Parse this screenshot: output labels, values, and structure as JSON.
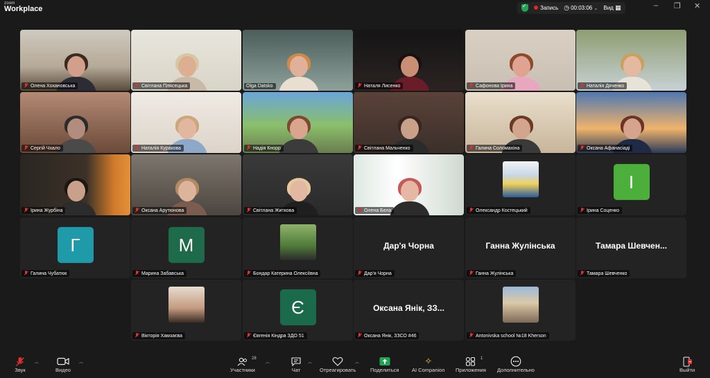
{
  "app": {
    "logo_small": "zoom",
    "logo_big": "Workplace"
  },
  "status": {
    "recording_label": "Запись",
    "timer": "00:03:06",
    "view_label": "Вид"
  },
  "colors": {
    "active_border": "#3fd16f",
    "mic_muted": "#e03030",
    "share_green": "#23a455",
    "record_red": "#e02828"
  },
  "participants": [
    {
      "name": "Олена Хохановська",
      "type": "video"
    },
    {
      "name": "Світлана Плясецька",
      "type": "video"
    },
    {
      "name": "Olga Datsko",
      "type": "video",
      "active": true
    },
    {
      "name": "Наталя Лисенко",
      "type": "video"
    },
    {
      "name": "Сафонова Ірина",
      "type": "video"
    },
    {
      "name": "Наталія Дяченко",
      "type": "video"
    },
    {
      "name": "Сергій Чхало",
      "type": "video"
    },
    {
      "name": "Наталія Куракова",
      "type": "video"
    },
    {
      "name": "Надія Кнорр",
      "type": "video"
    },
    {
      "name": "Світлана Мальченко",
      "type": "video"
    },
    {
      "name": "Галина Соломахіна",
      "type": "video"
    },
    {
      "name": "Оксана Афанасіаді",
      "type": "video"
    },
    {
      "name": "Ірина Журбіна",
      "type": "video"
    },
    {
      "name": "Оксана Арутюнова",
      "type": "video"
    },
    {
      "name": "Світлана Житкова",
      "type": "video"
    },
    {
      "name": "Олена Бела",
      "type": "video"
    },
    {
      "name": "Олександр Костецький",
      "type": "photo"
    },
    {
      "name": "Ірина Соценко",
      "type": "letter",
      "letter": "І",
      "color": "#4caf3c"
    },
    {
      "name": "Галина Чубатюк",
      "type": "letter",
      "letter": "Г",
      "color": "#1f9aa8"
    },
    {
      "name": "Марина Забавська",
      "type": "letter",
      "letter": "М",
      "color": "#1d6b4a"
    },
    {
      "name": "Бондар Катерина Олексіївна",
      "type": "photo"
    },
    {
      "name": "Дар'я Чорна",
      "type": "name",
      "display": "Дар'я Чорна"
    },
    {
      "name": "Ганна Жулінська",
      "type": "name",
      "display": "Ганна Жулінська"
    },
    {
      "name": "Тамара Шевченко",
      "type": "name",
      "display": "Тамара  Шевчен..."
    },
    {
      "name": "Вікторія Хамзаєва",
      "type": "photo"
    },
    {
      "name": "Євгенія Кіндра ЗДО 51",
      "type": "letter",
      "letter": "Є",
      "color": "#1b6a4c"
    },
    {
      "name": "Оксана Янік, ЗЗСО #46",
      "type": "name",
      "display": "Оксана Янік, ЗЗ..."
    },
    {
      "name": "Antonivska  school №18 Kherson",
      "type": "photo"
    }
  ],
  "toolbar": {
    "mute_label": "Звук",
    "video_label": "Видео",
    "participants_label": "Участники",
    "participants_count": "28",
    "chat_label": "Чат",
    "react_label": "Отреагировать",
    "share_label": "Поделиться",
    "ai_label": "AI Companion",
    "apps_label": "Приложения",
    "apps_count": "1",
    "more_label": "Дополнительно",
    "leave_label": "Выйти"
  }
}
